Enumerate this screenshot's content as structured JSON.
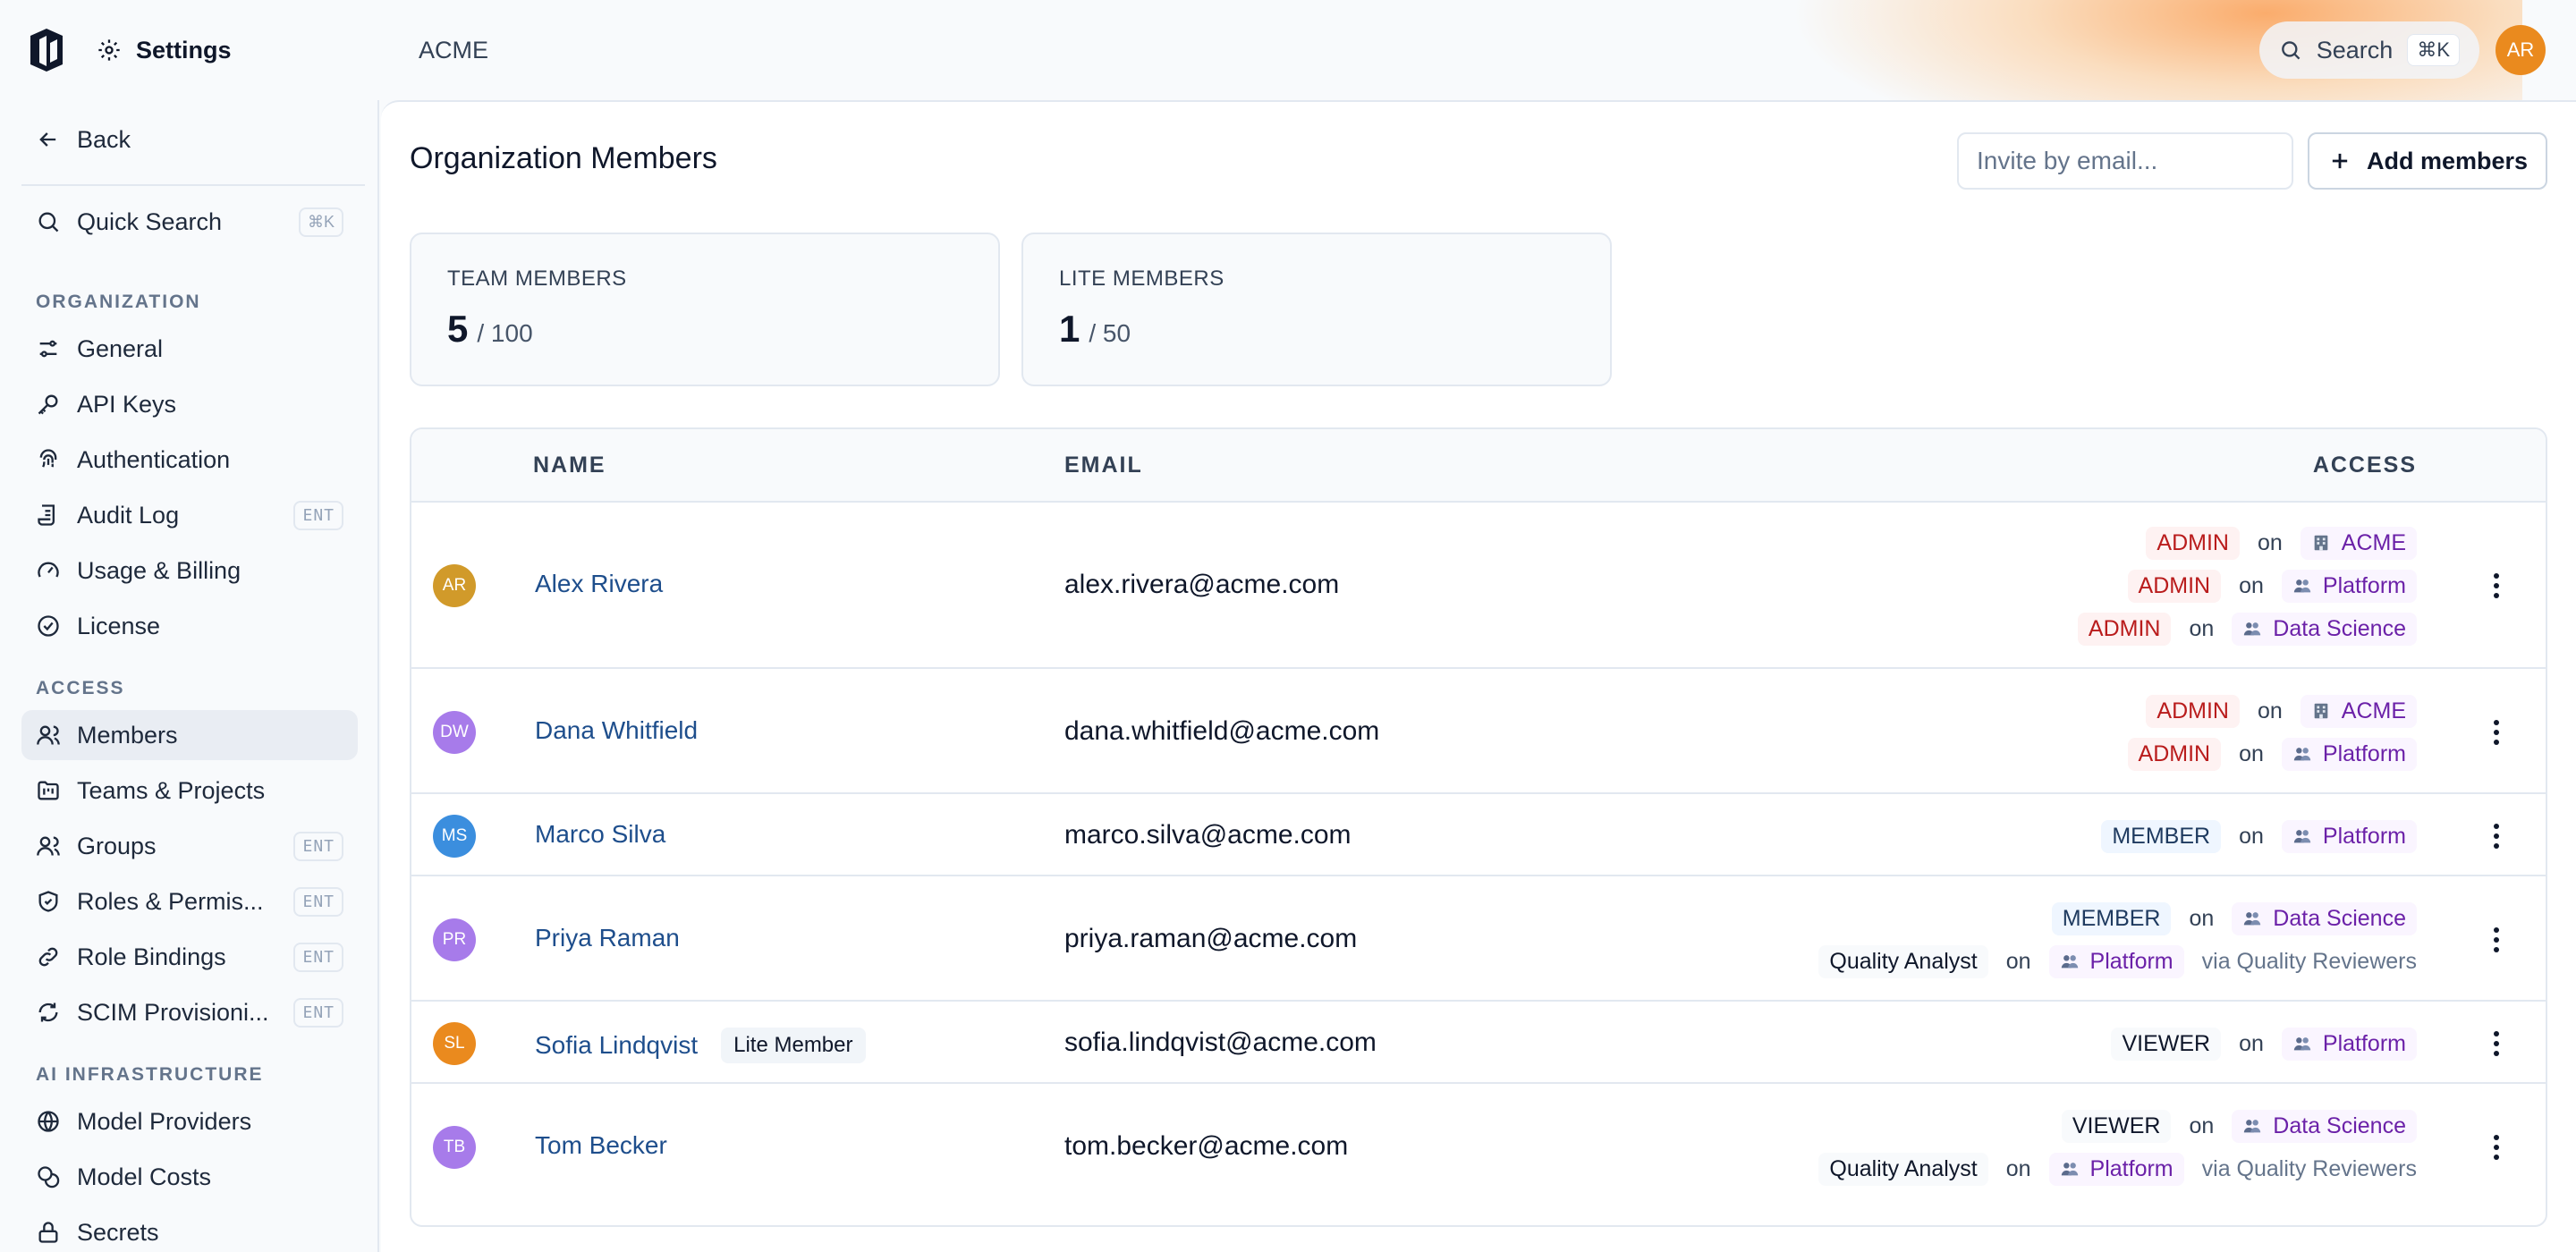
{
  "header": {
    "title": "Settings",
    "org": "ACME",
    "search_label": "Search",
    "search_shortcut": "⌘K",
    "user_initials": "AR"
  },
  "sidebar": {
    "back_label": "Back",
    "quick_search_label": "Quick Search",
    "quick_search_shortcut": "⌘K",
    "sections": {
      "organization": "ORGANIZATION",
      "access": "ACCESS",
      "ai_infra": "AI INFRASTRUCTURE"
    },
    "items": {
      "general": "General",
      "api_keys": "API Keys",
      "authentication": "Authentication",
      "audit_log": "Audit Log",
      "usage_billing": "Usage & Billing",
      "license": "License",
      "members": "Members",
      "teams_projects": "Teams & Projects",
      "groups": "Groups",
      "roles": "Roles & Permis...",
      "role_bindings": "Role Bindings",
      "scim": "SCIM Provisioni...",
      "model_providers": "Model Providers",
      "model_costs": "Model Costs",
      "secrets": "Secrets"
    },
    "ent_badge": "ENT"
  },
  "main": {
    "title": "Organization Members",
    "invite_placeholder": "Invite by email...",
    "add_members_label": "Add members",
    "stats": {
      "team_label": "TEAM MEMBERS",
      "team_count": "5",
      "team_limit": "/ 100",
      "lite_label": "LITE MEMBERS",
      "lite_count": "1",
      "lite_limit": "/ 50"
    },
    "table": {
      "headers": {
        "name": "NAME",
        "email": "EMAIL",
        "access": "ACCESS"
      },
      "on_word": "on",
      "rows": [
        {
          "initials": "AR",
          "color": "#d19a2a",
          "name": "Alex Rivera",
          "email": "alex.rivera@acme.com",
          "access": [
            {
              "role": "ADMIN",
              "target": "ACME",
              "kind": "org"
            },
            {
              "role": "ADMIN",
              "target": "Platform",
              "kind": "team"
            },
            {
              "role": "ADMIN",
              "target": "Data Science",
              "kind": "team"
            }
          ]
        },
        {
          "initials": "DW",
          "color": "#a77bea",
          "name": "Dana Whitfield",
          "email": "dana.whitfield@acme.com",
          "access": [
            {
              "role": "ADMIN",
              "target": "ACME",
              "kind": "org"
            },
            {
              "role": "ADMIN",
              "target": "Platform",
              "kind": "team"
            }
          ]
        },
        {
          "initials": "MS",
          "color": "#3b8ede",
          "name": "Marco Silva",
          "email": "marco.silva@acme.com",
          "access": [
            {
              "role": "MEMBER",
              "target": "Platform",
              "kind": "team"
            }
          ]
        },
        {
          "initials": "PR",
          "color": "#a77bea",
          "name": "Priya Raman",
          "email": "priya.raman@acme.com",
          "access": [
            {
              "role": "MEMBER",
              "target": "Data Science",
              "kind": "team"
            },
            {
              "role": "Quality Analyst",
              "target": "Platform",
              "kind": "team",
              "via": "via Quality Reviewers"
            }
          ]
        },
        {
          "initials": "SL",
          "color": "#ea8a1e",
          "name": "Sofia Lindqvist",
          "badge": "Lite Member",
          "email": "sofia.lindqvist@acme.com",
          "access": [
            {
              "role": "VIEWER",
              "target": "Platform",
              "kind": "team"
            }
          ]
        },
        {
          "initials": "TB",
          "color": "#a77bea",
          "name": "Tom Becker",
          "email": "tom.becker@acme.com",
          "access": [
            {
              "role": "VIEWER",
              "target": "Data Science",
              "kind": "team"
            },
            {
              "role": "Quality Analyst",
              "target": "Platform",
              "kind": "team",
              "via": "via Quality Reviewers"
            }
          ]
        }
      ]
    }
  },
  "colors": {
    "accent_orange": "#ea8a1e",
    "link_blue": "#1e4e8c",
    "admin_red": "#b91c1c",
    "target_purple": "#6b21a8"
  }
}
